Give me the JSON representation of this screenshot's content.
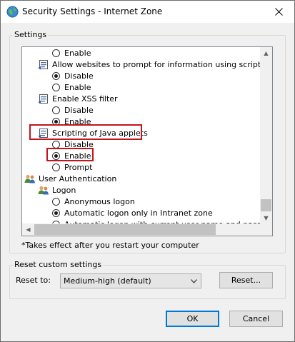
{
  "window": {
    "title": "Security Settings - Internet Zone"
  },
  "settings_group": {
    "label": "Settings"
  },
  "tree": [
    {
      "kind": "radio",
      "checked": false,
      "label": "Enable"
    },
    {
      "kind": "setting",
      "label": "Allow websites to prompt for information using scripted windo"
    },
    {
      "kind": "radio",
      "checked": true,
      "label": "Disable"
    },
    {
      "kind": "radio",
      "checked": false,
      "label": "Enable"
    },
    {
      "kind": "setting",
      "label": "Enable XSS filter"
    },
    {
      "kind": "radio",
      "checked": false,
      "label": "Disable"
    },
    {
      "kind": "radio",
      "checked": true,
      "label": "Enable"
    },
    {
      "kind": "setting",
      "label": "Scripting of Java applets"
    },
    {
      "kind": "radio",
      "checked": false,
      "label": "Disable"
    },
    {
      "kind": "radio",
      "checked": true,
      "label": "Enable"
    },
    {
      "kind": "radio",
      "checked": false,
      "label": "Prompt"
    },
    {
      "kind": "category",
      "label": "User Authentication"
    },
    {
      "kind": "subcategory",
      "label": "Logon"
    },
    {
      "kind": "radio",
      "checked": false,
      "label": "Anonymous logon"
    },
    {
      "kind": "radio",
      "checked": true,
      "label": "Automatic logon only in Intranet zone"
    },
    {
      "kind": "radio",
      "checked": false,
      "label": "Automatic logon with current user name and password"
    }
  ],
  "note": "*Takes effect after you restart your computer",
  "reset_group": {
    "label": "Reset custom settings",
    "reset_to_label": "Reset to:",
    "selected": "Medium-high (default)",
    "reset_button": "Reset..."
  },
  "buttons": {
    "ok": "OK",
    "cancel": "Cancel"
  },
  "colors": {
    "highlight": "#c0161c",
    "default_button": "#0078d7"
  }
}
